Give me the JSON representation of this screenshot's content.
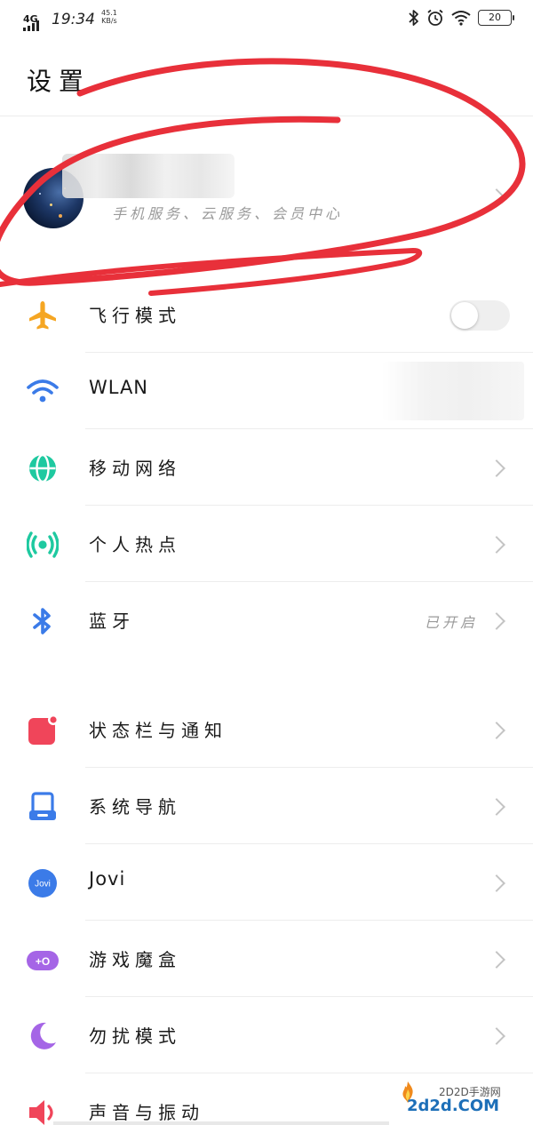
{
  "status_bar": {
    "network": "4G",
    "time": "19:34",
    "speed_value": "45.1",
    "speed_unit": "KB/s",
    "battery": "20",
    "icons": [
      "bluetooth-icon",
      "alarm-icon",
      "wifi-icon",
      "battery-icon"
    ]
  },
  "page": {
    "title": "设置"
  },
  "account": {
    "subtitle": "手机服务、云服务、会员中心"
  },
  "sections": [
    {
      "items": [
        {
          "label": "飞行模式",
          "icon": "airplane-icon",
          "color": "#f5a623",
          "control": "toggle",
          "toggle_on": false
        },
        {
          "label": "WLAN",
          "icon": "wifi-icon",
          "color": "#3b7be8",
          "control": "none"
        },
        {
          "label": "移动网络",
          "icon": "globe-icon",
          "color": "#1ec9a0",
          "control": "chevron"
        },
        {
          "label": "个人热点",
          "icon": "hotspot-icon",
          "color": "#1ec9a0",
          "control": "chevron"
        },
        {
          "label": "蓝牙",
          "icon": "bluetooth-icon",
          "color": "#3b7be8",
          "control": "chevron",
          "value": "已开启"
        }
      ]
    },
    {
      "items": [
        {
          "label": "状态栏与通知",
          "icon": "notification-icon",
          "color": "#f0455a",
          "control": "chevron"
        },
        {
          "label": "系统导航",
          "icon": "navigation-icon",
          "color": "#3b7be8",
          "control": "chevron"
        },
        {
          "label": "Jovi",
          "icon": "jovi-icon",
          "icon_text": "Jovi",
          "color": "#3b7be8",
          "control": "chevron"
        },
        {
          "label": "游戏魔盒",
          "icon": "game-box-icon",
          "icon_text": "+O",
          "color": "#a565e6",
          "control": "chevron"
        },
        {
          "label": "勿扰模式",
          "icon": "moon-icon",
          "color": "#a565e6",
          "control": "chevron"
        },
        {
          "label": "声音与振动",
          "icon": "speaker-icon",
          "color": "#f0455a",
          "control": "chevron"
        }
      ]
    }
  ],
  "watermark": {
    "site_name": "2D2D手游网",
    "url": "2d2d.COM"
  },
  "colors": {
    "annotation_circle": "#e8303a",
    "divider": "#ededed",
    "secondary_text": "#9a9a9a"
  }
}
